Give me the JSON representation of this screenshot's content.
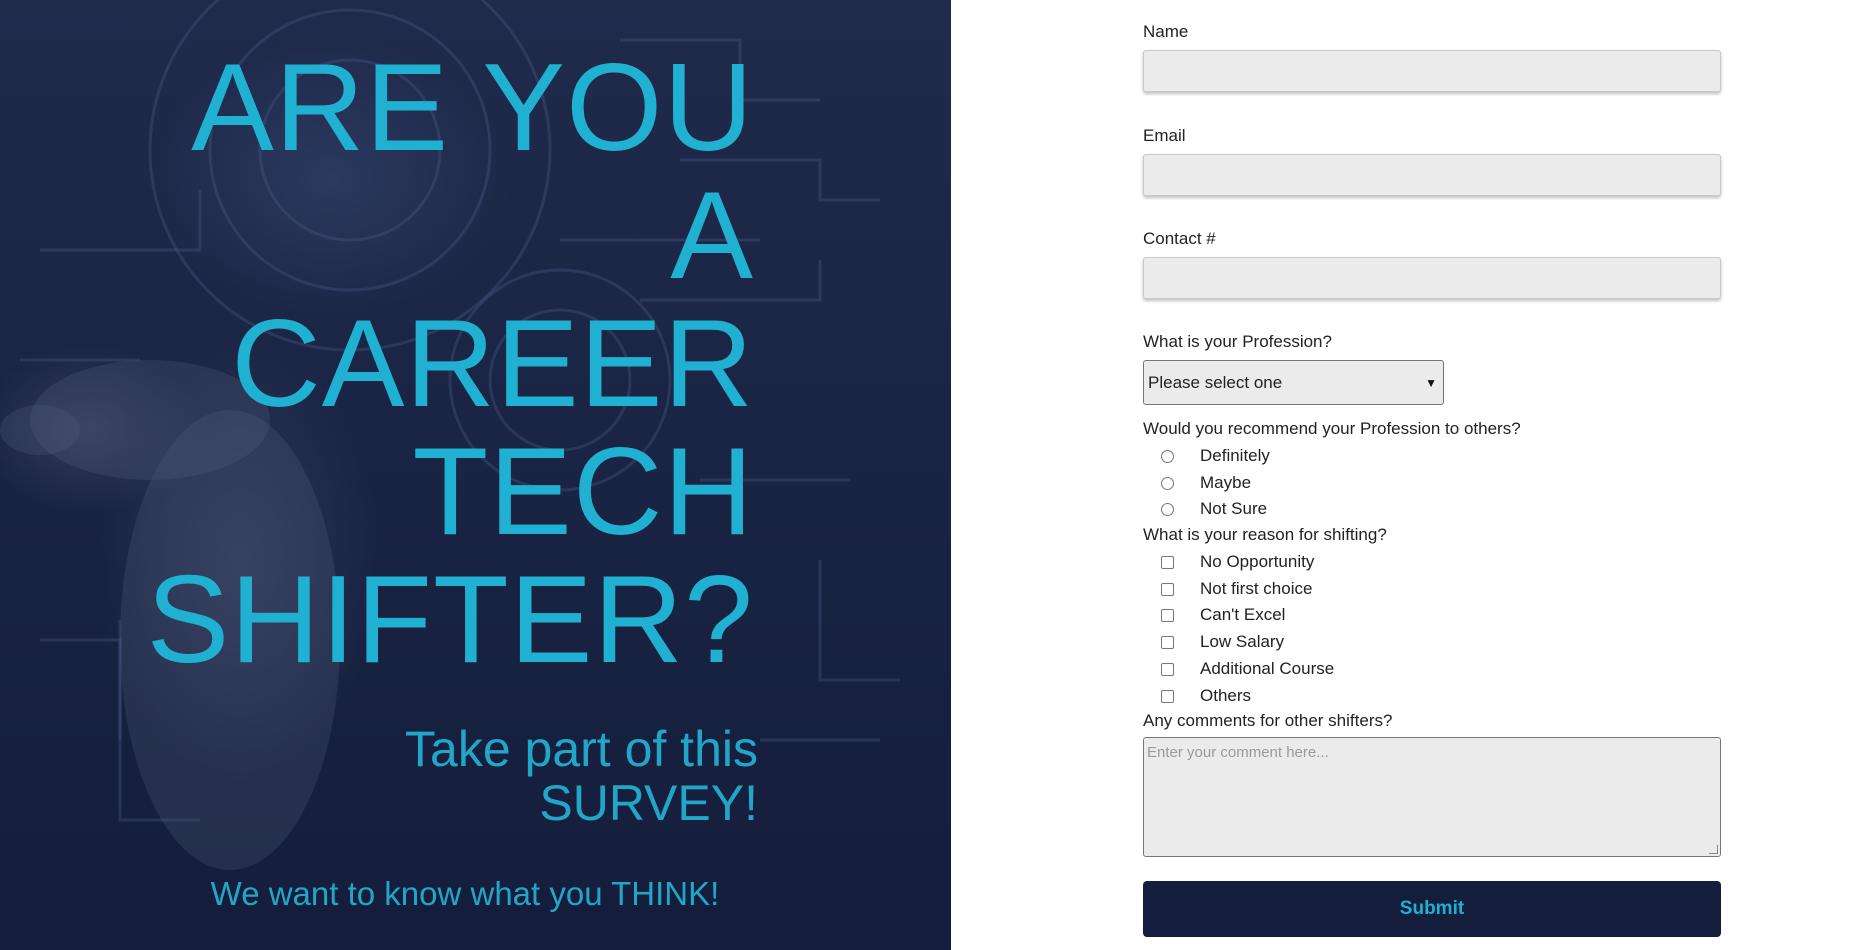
{
  "hero": {
    "title_lines": [
      "ARE YOU",
      "A",
      "CAREER",
      "TECH",
      "SHIFTER?"
    ],
    "subtitle_lines": [
      "Take part of this",
      "SURVEY!"
    ],
    "tagline": "We want to know what you THINK!"
  },
  "form": {
    "name_label": "Name",
    "name_value": "",
    "email_label": "Email",
    "email_value": "",
    "contact_label": "Contact #",
    "contact_value": "",
    "profession_label": "What is your Profession?",
    "profession_selected": "Please select one",
    "recommend_label": "Would you recommend your Profession to others?",
    "recommend_options": [
      "Definitely",
      "Maybe",
      "Not Sure"
    ],
    "reason_label": "What is your reason for shifting?",
    "reason_options": [
      "No Opportunity",
      "Not first choice",
      "Can't Excel",
      "Low Salary",
      "Additional Course",
      "Others"
    ],
    "comments_label": "Any comments for other shifters?",
    "comments_placeholder": "Enter your comment here...",
    "submit_label": "Submit"
  },
  "colors": {
    "accent": "#1fb0d2",
    "navy": "#141d3b",
    "field_bg": "#ebebeb"
  }
}
